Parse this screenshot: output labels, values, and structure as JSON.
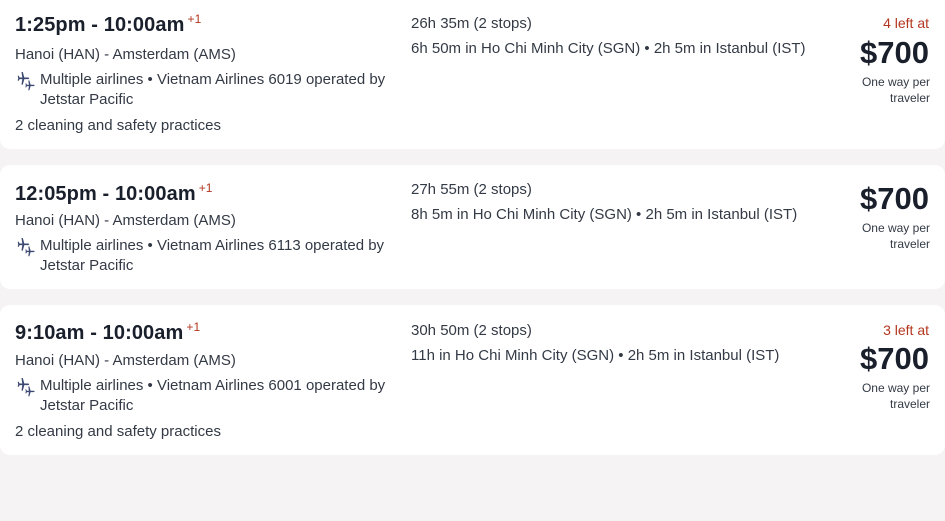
{
  "results": [
    {
      "depart": "1:25pm",
      "arrive": "10:00am",
      "time_sep": " - ",
      "day_offset": "+1",
      "route": "Hanoi (HAN) - Amsterdam (AMS)",
      "airline_info": "Multiple airlines • Vietnam Airlines 6019 operated by Jetstar Pacific",
      "practices": "2 cleaning and safety practices",
      "duration": "26h 35m (2 stops)",
      "layovers": "6h 50m in Ho Chi Minh City (SGN) • 2h 5m in Istanbul (IST)",
      "seats_left": "4 left at",
      "price": "$700",
      "price_note": "One way per traveler"
    },
    {
      "depart": "12:05pm",
      "arrive": "10:00am",
      "time_sep": " - ",
      "day_offset": "+1",
      "route": "Hanoi (HAN) - Amsterdam (AMS)",
      "airline_info": "Multiple airlines • Vietnam Airlines 6113 operated by Jetstar Pacific",
      "duration": "27h 55m (2 stops)",
      "layovers": "8h 5m in Ho Chi Minh City (SGN) • 2h 5m in Istanbul (IST)",
      "price": "$700",
      "price_note": "One way per traveler"
    },
    {
      "depart": "9:10am",
      "arrive": "10:00am",
      "time_sep": " - ",
      "day_offset": "+1",
      "route": "Hanoi (HAN) - Amsterdam (AMS)",
      "airline_info": "Multiple airlines • Vietnam Airlines 6001 operated by Jetstar Pacific",
      "practices": "2 cleaning and safety practices",
      "duration": "30h 50m (2 stops)",
      "layovers": "11h in Ho Chi Minh City (SGN) • 2h 5m in Istanbul (IST)",
      "seats_left": "3 left at",
      "price": "$700",
      "price_note": "One way per traveler"
    }
  ],
  "icons": {
    "airline": "multiple-airlines-plane-icon"
  },
  "colors": {
    "accent_red": "#b3361f",
    "text_dark": "#1a1f2c",
    "icon": "#3c4a73",
    "background": "#f5f3f4"
  }
}
